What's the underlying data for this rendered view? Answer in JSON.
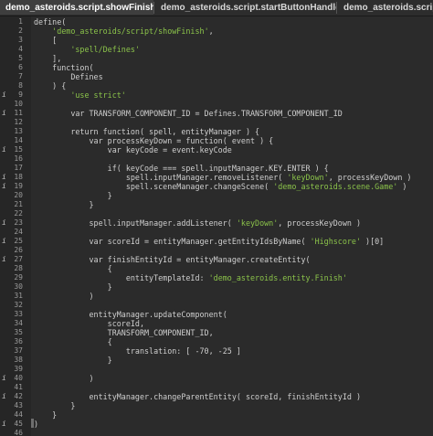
{
  "tabs": [
    {
      "label": "demo_asteroids.script.showFinish",
      "active": true,
      "close_glyph": "✕"
    },
    {
      "label": "demo_asteroids.script.startButtonHandler",
      "active": false
    },
    {
      "label": "demo_asteroids.script.s",
      "active": false
    }
  ],
  "gutter_marker": "i",
  "lines": [
    {
      "n": "1",
      "info": "",
      "code": "define("
    },
    {
      "n": "2",
      "info": "",
      "code": "    'demo_asteroids/script/showFinish',"
    },
    {
      "n": "3",
      "info": "",
      "code": "    ["
    },
    {
      "n": "4",
      "info": "",
      "code": "        'spell/Defines'"
    },
    {
      "n": "5",
      "info": "",
      "code": "    ],"
    },
    {
      "n": "6",
      "info": "",
      "code": "    function("
    },
    {
      "n": "7",
      "info": "",
      "code": "        Defines"
    },
    {
      "n": "8",
      "info": "",
      "code": "    ) {"
    },
    {
      "n": "9",
      "info": "i",
      "code": "        'use strict'"
    },
    {
      "n": "10",
      "info": "",
      "code": ""
    },
    {
      "n": "11",
      "info": "i",
      "code": "        var TRANSFORM_COMPONENT_ID = Defines.TRANSFORM_COMPONENT_ID"
    },
    {
      "n": "12",
      "info": "",
      "code": ""
    },
    {
      "n": "13",
      "info": "",
      "code": "        return function( spell, entityManager ) {"
    },
    {
      "n": "14",
      "info": "",
      "code": "            var processKeyDown = function( event ) {"
    },
    {
      "n": "15",
      "info": "i",
      "code": "                var keyCode = event.keyCode"
    },
    {
      "n": "16",
      "info": "",
      "code": ""
    },
    {
      "n": "17",
      "info": "",
      "code": "                if( keyCode === spell.inputManager.KEY.ENTER ) {"
    },
    {
      "n": "18",
      "info": "i",
      "code": "                    spell.inputManager.removeListener( 'keyDown', processKeyDown )"
    },
    {
      "n": "19",
      "info": "i",
      "code": "                    spell.sceneManager.changeScene( 'demo_asteroids.scene.Game' )"
    },
    {
      "n": "20",
      "info": "",
      "code": "                }"
    },
    {
      "n": "21",
      "info": "",
      "code": "            }"
    },
    {
      "n": "22",
      "info": "",
      "code": ""
    },
    {
      "n": "23",
      "info": "i",
      "code": "            spell.inputManager.addListener( 'keyDown', processKeyDown )"
    },
    {
      "n": "24",
      "info": "",
      "code": ""
    },
    {
      "n": "25",
      "info": "i",
      "code": "            var scoreId = entityManager.getEntityIdsByName( 'Highscore' )[0]"
    },
    {
      "n": "26",
      "info": "",
      "code": ""
    },
    {
      "n": "27",
      "info": "i",
      "code": "            var finishEntityId = entityManager.createEntity("
    },
    {
      "n": "28",
      "info": "",
      "code": "                {"
    },
    {
      "n": "29",
      "info": "",
      "code": "                    entityTemplateId: 'demo_asteroids.entity.Finish'"
    },
    {
      "n": "30",
      "info": "",
      "code": "                }"
    },
    {
      "n": "31",
      "info": "",
      "code": "            )"
    },
    {
      "n": "32",
      "info": "",
      "code": ""
    },
    {
      "n": "33",
      "info": "",
      "code": "            entityManager.updateComponent("
    },
    {
      "n": "34",
      "info": "",
      "code": "                scoreId,"
    },
    {
      "n": "35",
      "info": "",
      "code": "                TRANSFORM_COMPONENT_ID,"
    },
    {
      "n": "36",
      "info": "",
      "code": "                {"
    },
    {
      "n": "37",
      "info": "",
      "code": "                    translation: [ -70, -25 ]"
    },
    {
      "n": "38",
      "info": "",
      "code": "                }"
    },
    {
      "n": "39",
      "info": "",
      "code": ""
    },
    {
      "n": "40",
      "info": "i",
      "code": "            )"
    },
    {
      "n": "41",
      "info": "",
      "code": ""
    },
    {
      "n": "42",
      "info": "i",
      "code": "            entityManager.changeParentEntity( scoreId, finishEntityId )"
    },
    {
      "n": "43",
      "info": "",
      "code": "        }"
    },
    {
      "n": "44",
      "info": "",
      "code": "    }"
    },
    {
      "n": "45",
      "info": "i",
      "code": ")"
    },
    {
      "n": "46",
      "info": "",
      "code": ""
    }
  ]
}
